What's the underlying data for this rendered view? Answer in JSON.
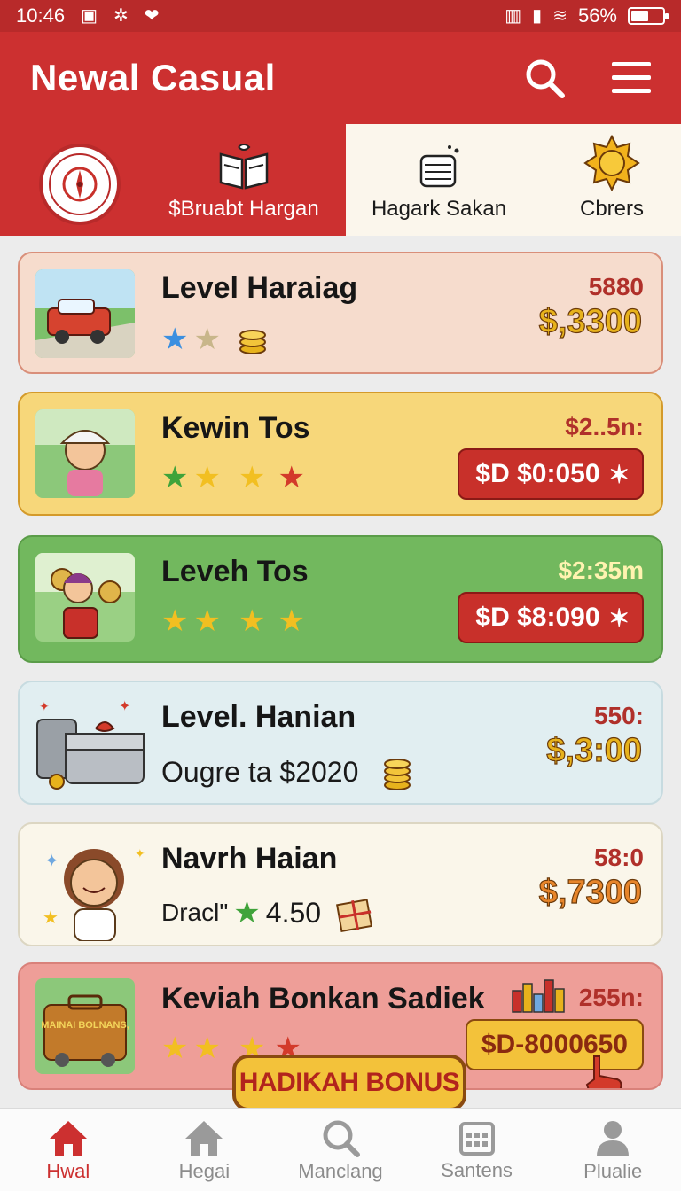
{
  "status": {
    "time": "10:46",
    "battery": "56%",
    "battery_level": 0.56
  },
  "header": {
    "title": "Newal Casual"
  },
  "tabs": [
    {
      "label": "$Bruabt Hargan",
      "active": true
    },
    {
      "label": "Hagark Sakan",
      "active": false
    },
    {
      "label": "Cbrers",
      "active": false
    }
  ],
  "cards": [
    {
      "title": "Level Haraiag",
      "top_value": "5880",
      "big_value": "$,3300",
      "bg": "#f6dccd",
      "border": "#d98f7a",
      "stars": [
        "#3b8fe0",
        "#c8b68a"
      ]
    },
    {
      "title": "Kewin Tos",
      "top_value": "$2..5n:",
      "pill": "$D $0:050",
      "bg": "#f7d77a",
      "border": "#d49a2a",
      "stars": [
        "#3fa33a",
        "#f2bf21",
        "#f2bf21",
        "#d33a2a"
      ]
    },
    {
      "title": "Leveh Tos",
      "top_value": "$2:35m",
      "pill": "$D $8:090",
      "bg": "#72b85e",
      "border": "#5a9c48",
      "stars": [
        "#f2bf21",
        "#f2bf21",
        "#f2bf21",
        "#f2bf21"
      ]
    },
    {
      "title": "Level. Hanian",
      "subtitle": "Ougre ta $2020",
      "top_value": "550:",
      "big_value": "$,3:00",
      "bg": "#e1eef1",
      "border": "#c7dbe0"
    },
    {
      "title": "Navrh Haian",
      "subtitle_prefix": "Dracl\"",
      "subtitle_value": "4.50",
      "top_value": "58:0",
      "big_value": "$,7300",
      "bg": "#faf6ea",
      "border": "#dcd6c2"
    },
    {
      "title": "Keviah Bonkan Sadiek",
      "top_value": "255n:",
      "pill": "$D-8000650",
      "bg": "#ee9e98",
      "border": "#d9817a",
      "stars": [
        "#f2bf21",
        "#f2bf21",
        "#f2bf21",
        "#d33a2a"
      ],
      "thumb_text": "MAINAI BOLNANS,"
    }
  ],
  "bonus_button": "HADIKAH BONUS",
  "nav": [
    {
      "label": "Hwal",
      "icon": "home-icon",
      "active": true
    },
    {
      "label": "Hegai",
      "icon": "house-icon",
      "active": false
    },
    {
      "label": "Manclang",
      "icon": "search-icon",
      "active": false
    },
    {
      "label": "Santens",
      "icon": "calendar-icon",
      "active": false
    },
    {
      "label": "Plualie",
      "icon": "profile-icon",
      "active": false
    }
  ],
  "colors": {
    "brand_red": "#cc3030",
    "status_red": "#b82a2a",
    "gold": "#e7b21c"
  }
}
